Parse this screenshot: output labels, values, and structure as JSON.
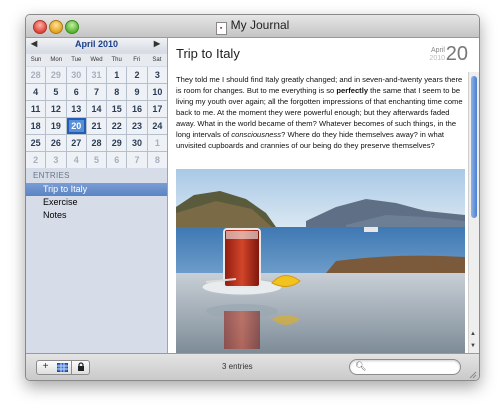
{
  "window": {
    "title": "My Journal",
    "doc_icon": "journal-doc-icon"
  },
  "calendar": {
    "month_label": "April 2010",
    "prev_label": "◀",
    "next_label": "▶",
    "weekdays": [
      "Sun",
      "Mon",
      "Tue",
      "Wed",
      "Thu",
      "Fri",
      "Sat"
    ],
    "weeks": [
      [
        "28",
        "29",
        "30",
        "31",
        "1",
        "2",
        "3"
      ],
      [
        "4",
        "5",
        "6",
        "7",
        "8",
        "9",
        "10"
      ],
      [
        "11",
        "12",
        "13",
        "14",
        "15",
        "16",
        "17"
      ],
      [
        "18",
        "19",
        "20",
        "21",
        "22",
        "23",
        "24"
      ],
      [
        "25",
        "26",
        "27",
        "28",
        "29",
        "30",
        "1"
      ],
      [
        "2",
        "3",
        "4",
        "5",
        "6",
        "7",
        "8"
      ]
    ],
    "selected_day": "20"
  },
  "sidebar": {
    "entries_label": "ENTRIES",
    "entries": [
      "Trip to Italy",
      "Exercise",
      "Notes"
    ]
  },
  "entry": {
    "title": "Trip to Italy",
    "date_month": "April",
    "date_year": "2010",
    "date_day": "20",
    "p1": "They told me I should find Italy greatly changed; and in seven-and-twenty years there is room for changes.  But to me everything is so ",
    "p1_bold": "perfectly",
    "p2": " the same that I seem to be living my youth over again; all the forgotten impressions of that enchanting time come back to me.  At the moment they were powerful enough; but they afterwards faded away.  What in the world became of them?  Whatever becomes of such things, in the long intervals of ",
    "p2_italic": "consciousness",
    "p3": "?  Where do they hide themselves away? in what unvisited cupboards and crannies of our being do they preserve themselves?"
  },
  "bottombar": {
    "add_label": "+",
    "count_label": "3 entries",
    "search_placeholder": ""
  },
  "colors": {
    "sidebar_bg": "#d6dde8",
    "selection": "#5a84c4",
    "calendar_selected": "#5a8fd6"
  }
}
